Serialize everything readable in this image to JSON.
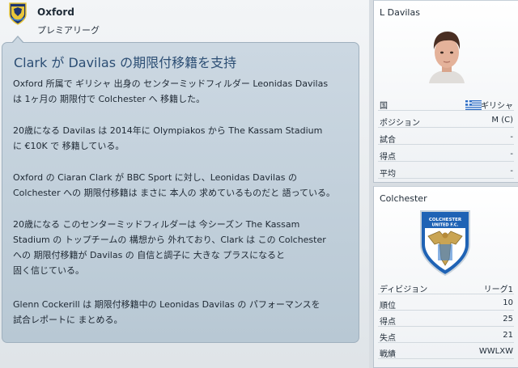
{
  "club": {
    "name": "Oxford",
    "league": "プレミアリーグ"
  },
  "news": {
    "title": "Clark が Davilas の期限付移籍を支持",
    "paragraphs": [
      [
        "Oxford 所属で ギリシャ 出身の センターミッドフィルダー Leonidas Davilas",
        "は 1ヶ月の 期限付で Colchester へ 移籍した。"
      ],
      [
        "20歳になる Davilas は 2014年に Olympiakos から The Kassam Stadium",
        "に €10K で 移籍している。"
      ],
      [
        "Oxford の Ciaran Clark が BBC Sport に対し、Leonidas Davilas の",
        "Colchester への 期限付移籍は まさに 本人の 求めているものだと 語っている。"
      ],
      [
        "20歳になる このセンターミッドフィルダーは 今シーズン The Kassam",
        "Stadium の トップチームの 構想から 外れており、Clark は この Colchester",
        "への 期限付移籍が Davilas の 自信と調子に 大きな プラスになると",
        "固く信じている。"
      ],
      [
        "Glenn Cockerill は 期限付移籍中の Leonidas Davilas の パフォーマンスを",
        "試合レポートに まとめる。"
      ]
    ]
  },
  "player_panel": {
    "name": "L Davilas",
    "rows": [
      {
        "label": "国",
        "value": "ギリシャ"
      },
      {
        "label": "ポジション",
        "value": "M (C)"
      },
      {
        "label": "試合",
        "value": "-"
      },
      {
        "label": "得点",
        "value": "-"
      },
      {
        "label": "平均",
        "value": "-"
      }
    ]
  },
  "club_panel": {
    "name": "Colchester",
    "badge_text": [
      "COLCHESTER",
      "UNITED F.C."
    ],
    "rows": [
      {
        "label": "ディビジョン",
        "value": "リーグ1"
      },
      {
        "label": "順位",
        "value": "10"
      },
      {
        "label": "得点",
        "value": "25"
      },
      {
        "label": "失点",
        "value": "21"
      },
      {
        "label": "戦績",
        "value": "WWLXW"
      }
    ]
  },
  "colors": {
    "title_blue": "#2c4e74",
    "bubble": "#c4d2dd",
    "crest_gold": "#e8c63a",
    "crest_navy": "#1e3570"
  },
  "icons": {
    "club_crest": "oxford-ox-crest",
    "flag": "greece-flag",
    "player_face": "player-portrait",
    "club_badge": "colchester-eagle-badge"
  }
}
